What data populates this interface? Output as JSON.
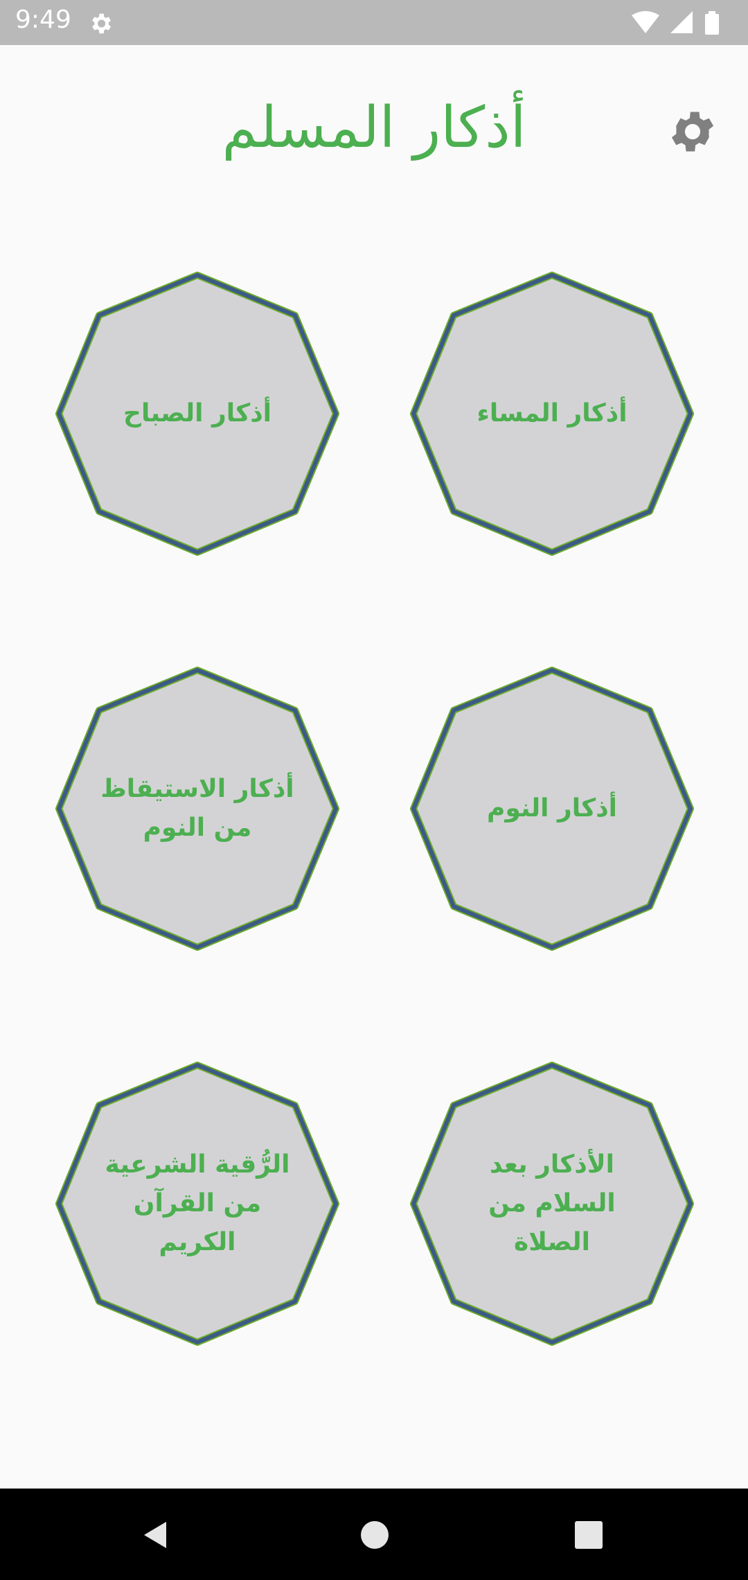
{
  "status_bar": {
    "time": "9:49",
    "icons": [
      "settings-icon",
      "wifi-icon",
      "signal-icon",
      "battery-icon"
    ]
  },
  "header": {
    "title": "أذكار المسلم",
    "settings_icon": "gear-icon"
  },
  "tiles": [
    {
      "label": "أذكار الصباح"
    },
    {
      "label": "أذكار المساء"
    },
    {
      "label": "أذكار الاستيقاظ من النوم"
    },
    {
      "label": "أذكار النوم"
    },
    {
      "label": "الرُّقية الشرعية من القرآن الكريم"
    },
    {
      "label": "الأذكار بعد السلام من الصلاة"
    }
  ],
  "colors": {
    "accent": "#4caf50",
    "tile_fill": "#d3d3d5",
    "tile_border_outer": "#6aaa2a",
    "tile_border_inner": "#3d5a86",
    "status_bar": "#b9b9b9",
    "nav_bar": "#000000"
  },
  "nav_bar": {
    "icons": [
      "back-icon",
      "home-icon",
      "recents-icon"
    ]
  }
}
